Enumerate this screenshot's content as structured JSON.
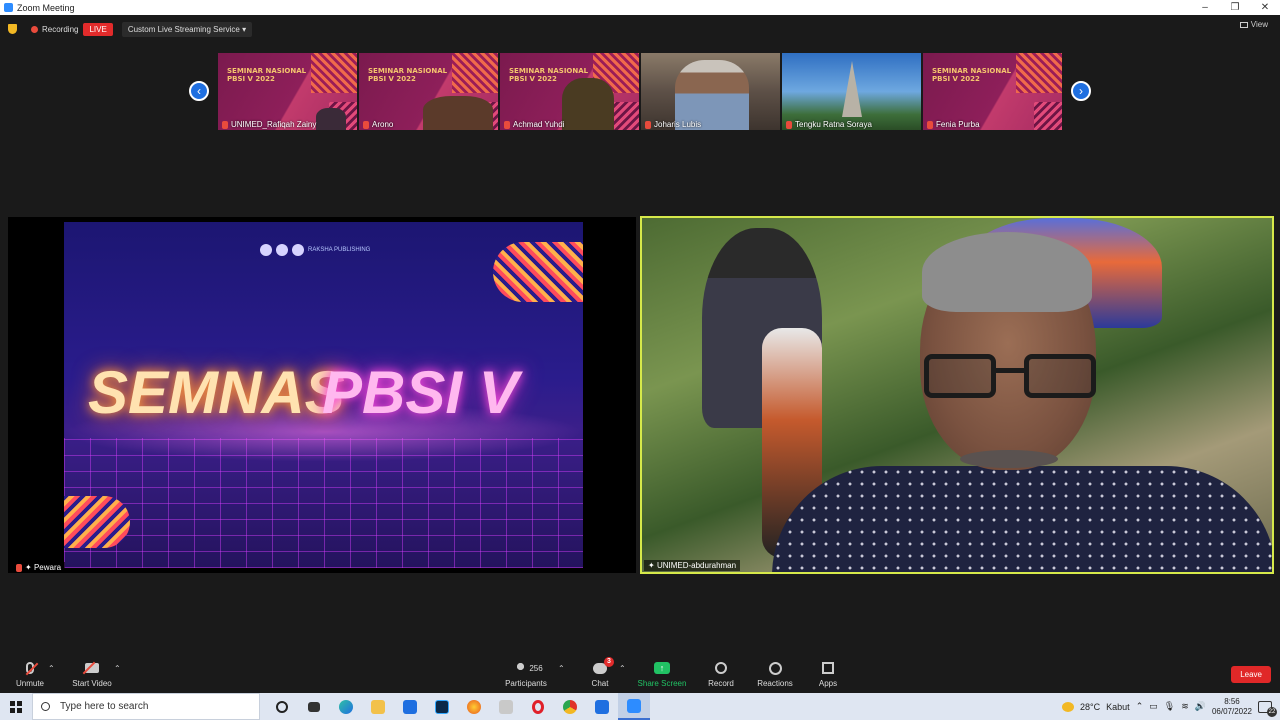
{
  "window": {
    "title": "Zoom Meeting",
    "controls": [
      "–",
      "❐",
      "✕"
    ]
  },
  "topbar": {
    "recording_label": "Recording",
    "live_label": "LIVE",
    "stream_label": "Custom Live Streaming Service",
    "view_label": "View"
  },
  "gallery": {
    "thumbs": [
      {
        "name": "UNIMED_Rafiqah Zainy",
        "muted": true,
        "bg": "seminar"
      },
      {
        "name": "Arono",
        "muted": true,
        "bg": "seminar"
      },
      {
        "name": "Achmad Yuhdi",
        "muted": true,
        "bg": "seminar"
      },
      {
        "name": "Joharis Lubis",
        "muted": true,
        "bg": "room"
      },
      {
        "name": "Tengku Ratna Soraya",
        "muted": true,
        "bg": "paris"
      },
      {
        "name": "Fenia Purba",
        "muted": true,
        "bg": "seminar"
      }
    ],
    "seminar_text": "SEMINAR NASIONAL\nPBSI V 2022",
    "prev_icon": "‹",
    "next_icon": "›"
  },
  "speakers": {
    "left": {
      "name": "Pewara",
      "slide_title_1": "SEMNAS",
      "slide_title_2": "PBSI V",
      "slide_logo_text": "RAKSHA PUBLISHING"
    },
    "right": {
      "name": "UNIMED-abdurahman",
      "active_color": "#d6e94a"
    }
  },
  "controls": {
    "unmute": "Unmute",
    "start_video": "Start Video",
    "participants": "Participants",
    "participants_count": "256",
    "chat": "Chat",
    "chat_badge": "3",
    "share_screen": "Share Screen",
    "record": "Record",
    "reactions": "Reactions",
    "apps": "Apps",
    "leave": "Leave"
  },
  "taskbar": {
    "search_placeholder": "Type here to search",
    "weather_temp": "28°C",
    "weather_text": "Kabut",
    "time": "8:56",
    "date": "06/07/2022",
    "notif_count": "22",
    "pinned_icons": [
      "task-view-icon",
      "edge-icon",
      "file-explorer-icon",
      "mail-icon",
      "photoshop-icon",
      "firefox-icon",
      "sticky-notes-icon",
      "opera-icon",
      "chrome-icon",
      "photos-icon",
      "zoom-icon"
    ]
  },
  "colors": {
    "brand": "#2d8cff",
    "live": "#e22b2b",
    "leave": "#e02828",
    "share": "#21c264"
  }
}
